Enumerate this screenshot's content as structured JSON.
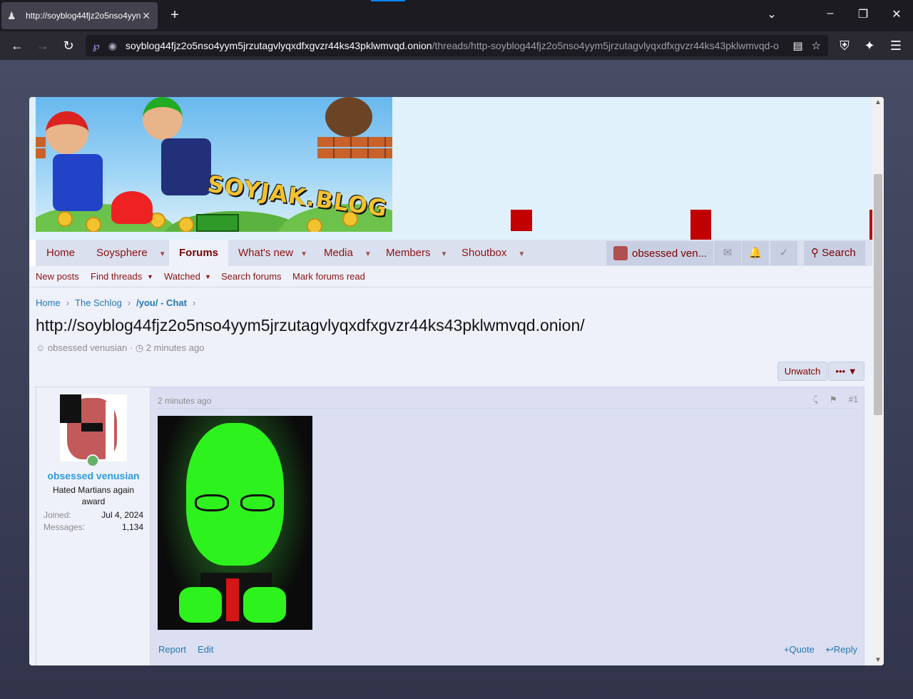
{
  "browser": {
    "tab_title": "http://soyblog44fjz2o5nso4yym5jrzutagvlyqxdfxgvzr44ks43pklwmvqd.onion/",
    "tab_title_short": "http://soyblog44fjz2o5nso4yyn",
    "url_host": "soyblog44fjz2o5nso4yym5jrzutagvlyqxdfxgvzr44ks43pklwmvqd.onion",
    "url_path": "/threads/http-soyblog44fjz2o5nso4yym5jrzutagvlyqxdfxgvzr44ks43pklwmvqd-o"
  },
  "banner": {
    "logo_text": "SOYJAK.BLOG"
  },
  "nav": {
    "items": [
      {
        "label": "Home"
      },
      {
        "label": "Soysphere"
      },
      {
        "label": "Forums"
      },
      {
        "label": "What's new"
      },
      {
        "label": "Media"
      },
      {
        "label": "Members"
      },
      {
        "label": "Shoutbox"
      }
    ],
    "user_label": "obsessed ven...",
    "search_label": "Search"
  },
  "subnav": {
    "items": [
      "New posts",
      "Find threads",
      "Watched",
      "Search forums",
      "Mark forums read"
    ]
  },
  "breadcrumbs": [
    "Home",
    "The Schlog",
    "/you/",
    "- Chat"
  ],
  "thread": {
    "title": "http://soyblog44fjz2o5nso4yym5jrzutagvlyqxdfxgvzr44ks43pklwmvqd.onion/",
    "author": "obsessed venusian",
    "time": "2 minutes ago",
    "unwatch_label": "Unwatch",
    "more_label": "•••"
  },
  "post": {
    "username": "obsessed venusian",
    "user_title": "Hated Martians again award",
    "joined_label": "Joined:",
    "joined_value": "Jul 4, 2024",
    "messages_label": "Messages:",
    "messages_value": "1,134",
    "date": "2 minutes ago",
    "number": "#1",
    "report_label": "Report",
    "edit_label": "Edit",
    "quote_label": "Quote",
    "reply_label": "Reply"
  }
}
